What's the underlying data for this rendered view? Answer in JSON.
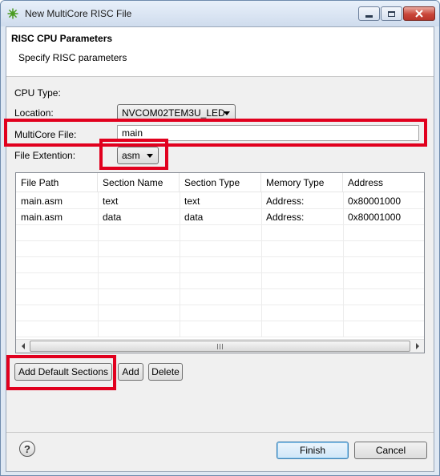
{
  "window": {
    "title": "New MultiCore RISC File",
    "controls": {
      "minimize_icon": "minimize-icon",
      "maximize_icon": "maximize-icon",
      "close_icon": "close-icon"
    }
  },
  "banner": {
    "title": "RISC CPU Parameters",
    "subtitle": "Specify RISC parameters"
  },
  "form": {
    "cpu_type_label": "CPU Type:",
    "location_label": "Location:",
    "location_value": "NVCOM02TEM3U_LED",
    "multicore_file_label": "MultiCore File:",
    "multicore_file_value": "main",
    "file_extension_label": "File Extention:",
    "file_extension_value": "asm"
  },
  "table": {
    "columns": [
      "File Path",
      "Section Name",
      "Section Type",
      "Memory Type",
      "Address"
    ],
    "rows": [
      [
        "main.asm",
        "text",
        "text",
        "Address:",
        "0x80001000"
      ],
      [
        "main.asm",
        "data",
        "data",
        "Address:",
        "0x80001000"
      ]
    ]
  },
  "buttons": {
    "add_default_sections": "Add Default Sections",
    "add": "Add",
    "delete": "Delete",
    "finish": "Finish",
    "cancel": "Cancel",
    "help": "?"
  },
  "colors": {
    "highlight": "#e1001e",
    "accent": "#3c7fb1"
  }
}
